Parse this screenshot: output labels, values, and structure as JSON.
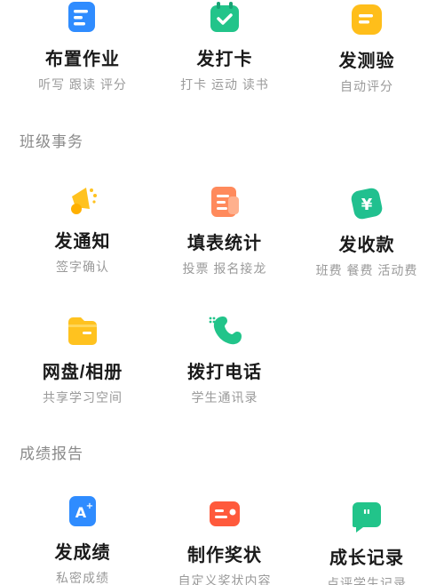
{
  "top_row": [
    {
      "title": "布置作业",
      "subtitle": "听写 跟读 评分",
      "icon": "assignment-doc-icon",
      "color": "#2f8cff"
    },
    {
      "title": "发打卡",
      "subtitle": "打卡 运动 读书",
      "icon": "checkin-calendar-icon",
      "color": "#22c48a"
    },
    {
      "title": "发测验",
      "subtitle": "自动评分",
      "icon": "quiz-doc-icon",
      "color": "#ffbe1a"
    }
  ],
  "class_affairs": {
    "heading": "班级事务",
    "items": [
      {
        "title": "发通知",
        "subtitle": "签字确认",
        "icon": "megaphone-icon",
        "color": "#ffc21f"
      },
      {
        "title": "填表统计",
        "subtitle": "投票 报名接龙",
        "icon": "form-sheet-icon",
        "color": "#ff8a5c"
      },
      {
        "title": "发收款",
        "subtitle": "班费 餐费 活动费",
        "icon": "yuan-payment-icon",
        "color": "#21c08f"
      },
      {
        "title": "网盘/相册",
        "subtitle": "共享学习空间",
        "icon": "folder-icon",
        "color": "#ffc21f"
      },
      {
        "title": "拨打电话",
        "subtitle": "学生通讯录",
        "icon": "phone-icon",
        "color": "#22c48a"
      }
    ]
  },
  "grade_report": {
    "heading": "成绩报告",
    "items": [
      {
        "title": "发成绩",
        "subtitle": "私密成绩",
        "icon": "grade-a-plus-icon",
        "color": "#2f8cff"
      },
      {
        "title": "制作奖状",
        "subtitle": "自定义奖状内容",
        "icon": "certificate-icon",
        "color": "#ff5a3c"
      },
      {
        "title": "成长记录",
        "subtitle": "点评学生记录",
        "icon": "quote-comment-icon",
        "color": "#22c48a"
      }
    ]
  }
}
